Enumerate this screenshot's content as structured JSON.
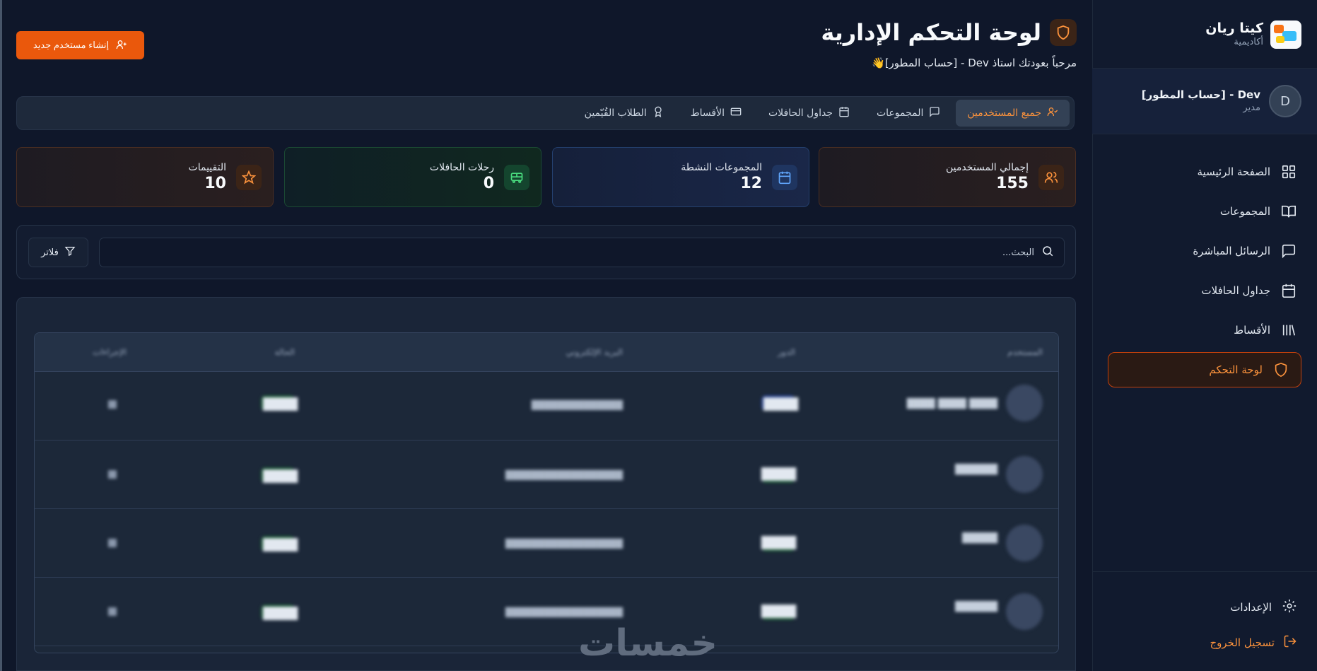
{
  "sidebar": {
    "brand_name": "كيتا ريان",
    "brand_sub": "أكاديمية",
    "profile": {
      "name": "Dev - [حساب المطور]",
      "role": "مدير",
      "initial": "D"
    },
    "nav": [
      {
        "label": "الصفحة الرئيسية",
        "icon": "grid-icon"
      },
      {
        "label": "المجموعات",
        "icon": "book-icon"
      },
      {
        "label": "الرسائل المباشرة",
        "icon": "chat-icon"
      },
      {
        "label": "جداول الحافلات",
        "icon": "calendar-icon"
      },
      {
        "label": "الأقساط",
        "icon": "library-icon"
      },
      {
        "label": "لوحة التحكم",
        "icon": "shield-icon",
        "active": true
      }
    ],
    "settings_label": "الإعدادات",
    "logout_label": "تسجيل الخروج"
  },
  "header": {
    "title": "لوحة التحكم الإدارية",
    "welcome": "مرحباً بعودتك استاذ Dev - [حساب المطور]👋",
    "create_user_label": "إنشاء مستخدم جديد"
  },
  "tabs": [
    {
      "label": "جميع المستخدمين",
      "icon": "user-check-icon",
      "active": true
    },
    {
      "label": "المجموعات",
      "icon": "chat-icon"
    },
    {
      "label": "جداول الحافلات",
      "icon": "calendar-icon"
    },
    {
      "label": "الأقساط",
      "icon": "card-icon"
    },
    {
      "label": "الطلاب القُيّمين",
      "icon": "award-icon"
    }
  ],
  "stats": [
    {
      "label": "إجمالي المستخدمين",
      "value": "155",
      "icon": "users-icon",
      "color": "#fb923c"
    },
    {
      "label": "المجموعات النشطة",
      "value": "12",
      "icon": "calendar-icon",
      "color": "#60a5fa"
    },
    {
      "label": "رحلات الحافلات",
      "value": "0",
      "icon": "bus-icon",
      "color": "#4ade80"
    },
    {
      "label": "التقييمات",
      "value": "10",
      "icon": "star-icon",
      "color": "#fb923c"
    }
  ],
  "search": {
    "placeholder": "البحث...",
    "filter_label": "فلاتر"
  },
  "table": {
    "headers": [
      "المستخدم",
      "الدور",
      "البريد الإلكتروني",
      "الحالة",
      "الإجراءات"
    ],
    "rows": [
      {
        "name": "████ ████ ████",
        "role": "████",
        "email": "██████████████",
        "status": "████"
      },
      {
        "name": "██████",
        "role": "████",
        "email": "██████████████████",
        "status": "████"
      },
      {
        "name": "█████",
        "role": "████",
        "email": "██████████████████",
        "status": "████"
      },
      {
        "name": "██████",
        "role": "████",
        "email": "██████████████████",
        "status": "████"
      }
    ]
  },
  "watermark": "خمسات",
  "colors": {
    "accent": "#f97316",
    "background": "#0f172a",
    "sidebar": "#111a2e"
  }
}
